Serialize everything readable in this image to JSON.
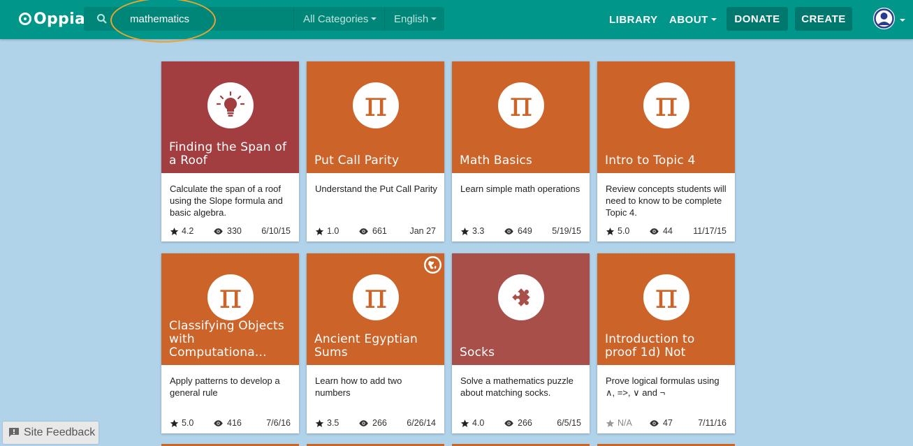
{
  "navbar": {
    "logo_text": "Oppia",
    "search_value": "mathematics",
    "category_label": "All Categories",
    "language_label": "English",
    "links": {
      "library": "LIBRARY",
      "about": "ABOUT"
    },
    "buttons": {
      "donate": "DONATE",
      "create": "CREATE"
    }
  },
  "colors": {
    "navbar": "#00968a",
    "page_bg": "#b0d3ea",
    "orange_card": "#cc6329",
    "red_card": "#a23d40",
    "puzzle_card": "#a94f4a",
    "highlight": "#e8a531"
  },
  "cards": [
    {
      "title": "Finding the Span of a Roof",
      "description": "Calculate the span of a roof using the Slope formula and basic algebra.",
      "rating": "4.2",
      "views": "330",
      "date": "6/10/15",
      "icon": "lightbulb-icon",
      "color": "#a23d40"
    },
    {
      "title": "Put Call Parity",
      "description": "Understand the Put Call Parity",
      "rating": "1.0",
      "views": "661",
      "date": "Jan 27",
      "icon": "pi-icon",
      "color": "#cc6329"
    },
    {
      "title": "Math Basics",
      "description": "Learn simple math operations",
      "rating": "3.3",
      "views": "649",
      "date": "5/19/15",
      "icon": "pi-icon",
      "color": "#cc6329"
    },
    {
      "title": "Intro to Topic 4",
      "description": "Review concepts students will need to know to be complete Topic 4.",
      "rating": "5.0",
      "views": "44",
      "date": "11/17/15",
      "icon": "pi-icon",
      "color": "#cc6329"
    },
    {
      "title": "Classifying Objects with Computationa...",
      "description": "Apply patterns to develop a general rule",
      "rating": "5.0",
      "views": "416",
      "date": "7/6/16",
      "icon": "pi-icon",
      "color": "#cc6329"
    },
    {
      "title": "Ancient Egyptian Sums",
      "description": "Learn how to add two numbers",
      "rating": "3.5",
      "views": "266",
      "date": "6/26/14",
      "icon": "pi-icon",
      "color": "#cc6329",
      "badge": "globe-icon"
    },
    {
      "title": "Socks",
      "description": "Solve a mathematics puzzle about matching socks.",
      "rating": "4.0",
      "views": "266",
      "date": "6/5/15",
      "icon": "puzzle-icon",
      "color": "#a94f4a"
    },
    {
      "title": "Introduction to proof 1d) Not",
      "description": "Prove logical formulas using ∧, =>, ∨ and ¬",
      "rating": "N/A",
      "views": "47",
      "date": "7/11/16",
      "icon": "pi-icon",
      "color": "#cc6329"
    }
  ],
  "feedback_label": "Site Feedback"
}
